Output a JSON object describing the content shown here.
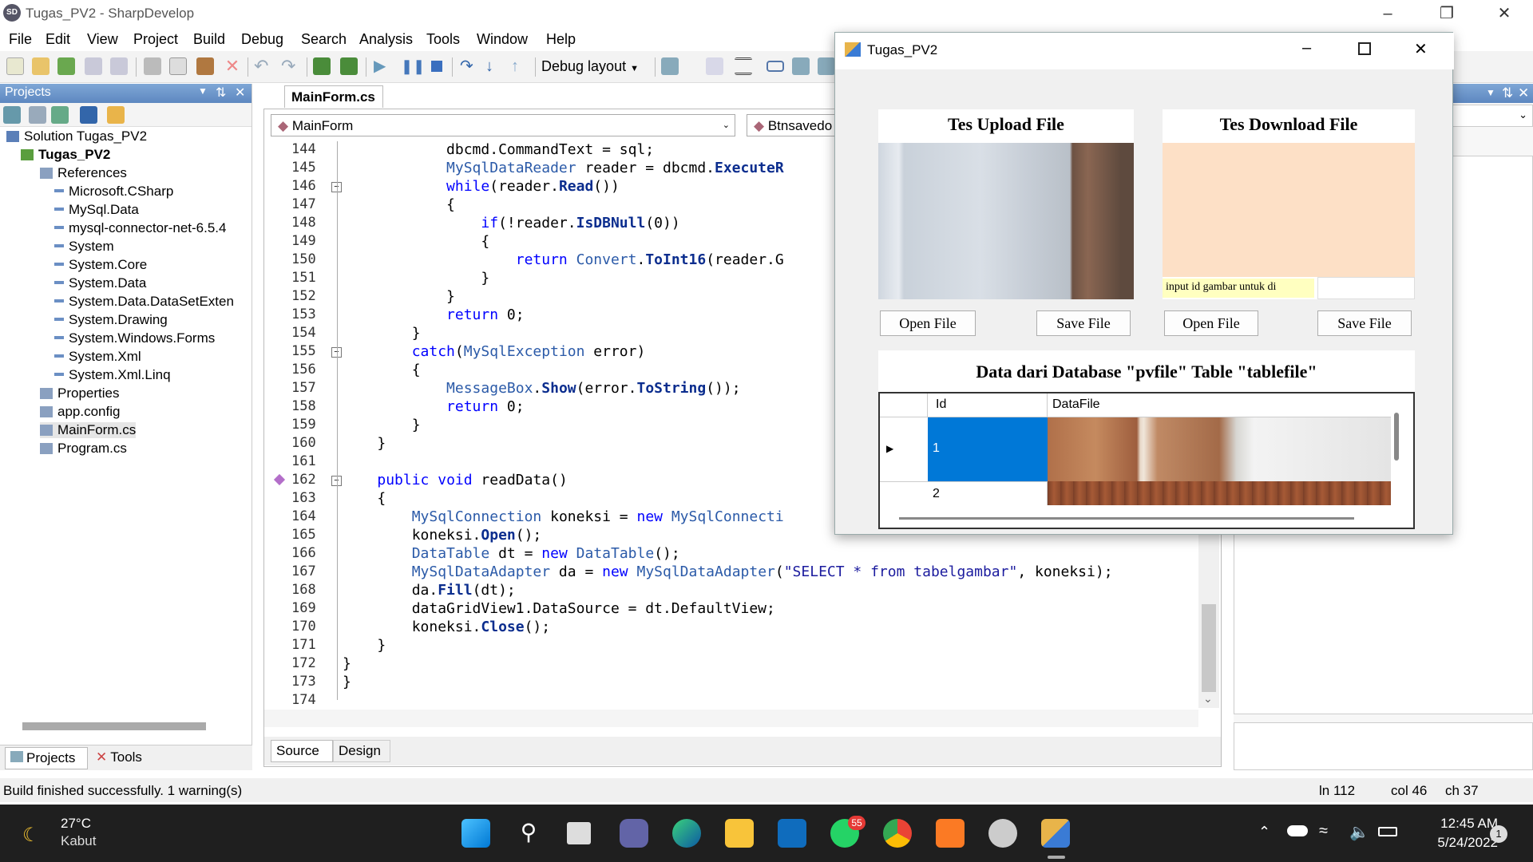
{
  "window": {
    "title": "Tugas_PV2 - SharpDevelop"
  },
  "menu": [
    "File",
    "Edit",
    "View",
    "Project",
    "Build",
    "Debug",
    "Search",
    "Analysis",
    "Tools",
    "Window",
    "Help"
  ],
  "toolbar": {
    "layout_dropdown": "Debug layout"
  },
  "projects_panel": {
    "title": "Projects",
    "tree": [
      {
        "label": "Solution Tugas_PV2",
        "level": 0
      },
      {
        "label": "Tugas_PV2",
        "level": 1,
        "bold": true
      },
      {
        "label": "References",
        "level": 2
      },
      {
        "label": "Microsoft.CSharp",
        "level": 3
      },
      {
        "label": "MySql.Data",
        "level": 3
      },
      {
        "label": "mysql-connector-net-6.5.4",
        "level": 3
      },
      {
        "label": "System",
        "level": 3
      },
      {
        "label": "System.Core",
        "level": 3
      },
      {
        "label": "System.Data",
        "level": 3
      },
      {
        "label": "System.Data.DataSetExten",
        "level": 3
      },
      {
        "label": "System.Drawing",
        "level": 3
      },
      {
        "label": "System.Windows.Forms",
        "level": 3
      },
      {
        "label": "System.Xml",
        "level": 3
      },
      {
        "label": "System.Xml.Linq",
        "level": 3
      },
      {
        "label": "Properties",
        "level": 2
      },
      {
        "label": "app.config",
        "level": 2
      },
      {
        "label": "MainForm.cs",
        "level": 2,
        "selected": true
      },
      {
        "label": "Program.cs",
        "level": 2
      }
    ],
    "bottom_tabs": [
      "Projects",
      "Tools"
    ]
  },
  "editor": {
    "tab": "MainForm.cs",
    "class_dropdown": "MainForm",
    "member_dropdown": "Btnsavedo",
    "lines": [
      {
        "n": "144",
        "code": "            dbcmd.CommandText = sql;"
      },
      {
        "n": "145",
        "code": "            MySqlDataReader reader = dbcmd.ExecuteR"
      },
      {
        "n": "146",
        "code": "            while(reader.Read())"
      },
      {
        "n": "147",
        "code": "            {"
      },
      {
        "n": "148",
        "code": "                if(!reader.IsDBNull(0))"
      },
      {
        "n": "149",
        "code": "                {"
      },
      {
        "n": "150",
        "code": "                    return Convert.ToInt16(reader.G"
      },
      {
        "n": "151",
        "code": "                }"
      },
      {
        "n": "152",
        "code": "            }"
      },
      {
        "n": "153",
        "code": "            return 0;"
      },
      {
        "n": "154",
        "code": "        }"
      },
      {
        "n": "155",
        "code": "        catch(MySqlException error)"
      },
      {
        "n": "156",
        "code": "        {"
      },
      {
        "n": "157",
        "code": "            MessageBox.Show(error.ToString());"
      },
      {
        "n": "158",
        "code": "            return 0;"
      },
      {
        "n": "159",
        "code": "        }"
      },
      {
        "n": "160",
        "code": "    }"
      },
      {
        "n": "161",
        "code": ""
      },
      {
        "n": "162",
        "code": "    public void readData()"
      },
      {
        "n": "163",
        "code": "    {"
      },
      {
        "n": "164",
        "code": "        MySqlConnection koneksi = new MySqlConnecti"
      },
      {
        "n": "165",
        "code": "        koneksi.Open();"
      },
      {
        "n": "166",
        "code": "        DataTable dt = new DataTable();"
      },
      {
        "n": "167",
        "code": "        MySqlDataAdapter da = new MySqlDataAdapter(\"SELECT * from tabelgambar\", koneksi);"
      },
      {
        "n": "168",
        "code": "        da.Fill(dt);"
      },
      {
        "n": "169",
        "code": "        dataGridView1.DataSource = dt.DefaultView;"
      },
      {
        "n": "170",
        "code": "        koneksi.Close();"
      },
      {
        "n": "171",
        "code": "    }"
      },
      {
        "n": "172",
        "code": "}"
      },
      {
        "n": "173",
        "code": "}"
      },
      {
        "n": "174",
        "code": ""
      }
    ],
    "bottom_tabs": [
      "Source",
      "Design"
    ]
  },
  "form": {
    "title": "Tugas_PV2",
    "upload_title": "Tes Upload File",
    "download_title": "Tes Download File",
    "id_label": "input id gambar untuk di",
    "id_value": "",
    "open_file": "Open File",
    "save_file": "Save File",
    "open_file2": "Open File",
    "save_file2": "Save File",
    "db_title": "Data dari Database \"pvfile\" Table \"tablefile\"",
    "grid": {
      "columns": [
        "Id",
        "DataFile"
      ],
      "rows": [
        {
          "id": "1"
        },
        {
          "id": "2"
        }
      ]
    },
    "download_color": "#fde0c6"
  },
  "status": {
    "message": "Build finished successfully. 1 warning(s)",
    "ln": "ln 112",
    "col": "col 46",
    "ch": "ch 37"
  },
  "taskbar": {
    "weather_temp": "27°C",
    "weather_desc": "Kabut",
    "time": "12:45 AM",
    "date": "5/24/2022",
    "whatsapp_badge": "55",
    "notif_count": "1"
  }
}
